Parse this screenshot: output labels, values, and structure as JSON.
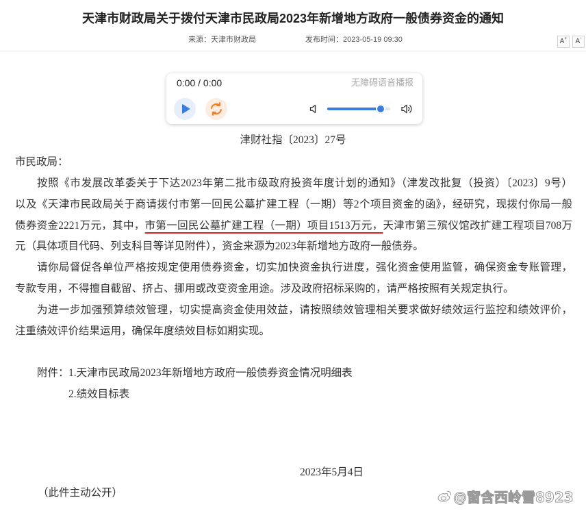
{
  "page": {
    "title": "天津市财政局关于拨付天津市民政局2023年新增地方政府一般债券资金的通知",
    "source_label": "来源：",
    "source": "天津市财政局",
    "publish_label": "发布时间：",
    "publish_time": "2023-05-19 09:30",
    "font_size_controls": [
      {
        "label": "A",
        "mark": "+",
        "icon": "font-increase-icon"
      },
      {
        "label": "A",
        "mark": "-",
        "icon": "font-decrease-icon"
      }
    ]
  },
  "audio_player": {
    "time": "0:00 / 0:00",
    "label": "无障碍语音播报",
    "volume": 0.85,
    "icons": {
      "play": "play-icon",
      "loop": "loop-icon",
      "volume_low": "volume-low-icon",
      "volume_high": "volume-high-icon"
    }
  },
  "document": {
    "number": "津财社指〔2023〕27号",
    "addressee": "市民政局：",
    "paragraphs": [
      {
        "lines": [
          "按照《市发展改革委关于下达2023年第二批市级政府投资年度计划的通知》（津发改批复（投资）〔2023〕9号）",
          "以及《天津市民政局关于商请拨付市第一回民公墓扩建工程（一期）等2个项目资金的函》，经研究，现拨付你局一般",
          {
            "before": "债券资金2221万元，其中，",
            "highlight": "市第一回民公墓扩建工程（一期）项目1513万元，",
            "after": "天津市第三殡仪馆改扩建工程项目708万"
          },
          "元（具体项目代码、列支科目等详见附件），资金来源为2023年新增地方政府一般债券。"
        ]
      },
      {
        "lines": [
          "请你局督促各单位严格按规定使用债券资金，切实加快资金执行进度，强化资金使用监管，确保资金专账管理，",
          "专款专用，不得擅自截留、挤占、挪用或改变资金用途。涉及政府招标采购的，请严格按照有关规定执行。"
        ]
      },
      {
        "lines": [
          "为进一步加强预算绩效管理，切实提高资金使用效益，请按照绩效管理相关要求做好绩效运行监控和绩效评价，",
          "注重绩效评价结果运用，确保年度绩效目标如期实现。"
        ]
      }
    ],
    "attachments": {
      "label": "附件：",
      "items": [
        "1.天津市民政局2023年新增地方政府一般债券资金情况明细表",
        "2.绩效目标表"
      ]
    },
    "date": "2023年5月4日",
    "disclosure": "（此件主动公开）"
  },
  "watermark": {
    "text": "@窗含西岭雪8923",
    "icon": "weibo-logo-icon"
  },
  "colors": {
    "text": "#333333",
    "accent": "#3b7ddd",
    "loop": "#f08028",
    "highlight": "#e02020",
    "muted": "#999999"
  }
}
